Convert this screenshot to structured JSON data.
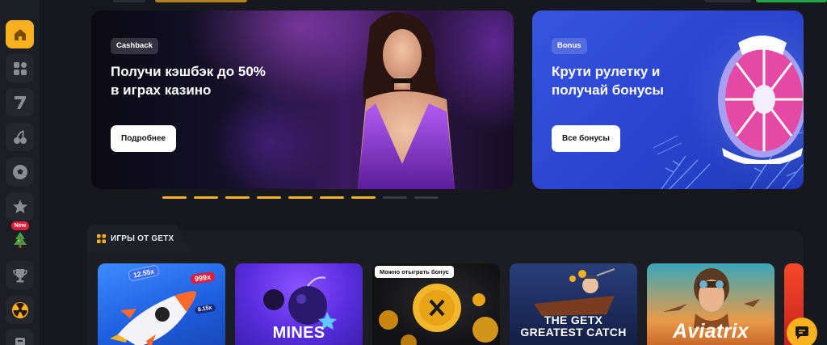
{
  "colors": {
    "accent": "#f9b11f",
    "background": "#17181d",
    "sidebar": "#1d1e24",
    "bonus_banner": "#2e4ad6",
    "new_badge": "#e01e3c"
  },
  "sidebar": {
    "items": [
      {
        "name": "home",
        "icon": "home-icon",
        "active": true
      },
      {
        "name": "categories",
        "icon": "grid-icon",
        "active": false
      },
      {
        "name": "slots",
        "icon": "seven-icon",
        "active": false
      },
      {
        "name": "fruits",
        "icon": "cherry-icon",
        "active": false
      },
      {
        "name": "sports",
        "icon": "soccer-ball-icon",
        "active": false
      },
      {
        "name": "favorites",
        "icon": "star-icon",
        "active": false
      },
      {
        "name": "new-year",
        "icon": "christmas-tree-icon",
        "active": false
      },
      {
        "name": "tournaments",
        "icon": "trophy-icon",
        "active": false
      },
      {
        "name": "game",
        "icon": "radiation-icon",
        "active": false
      },
      {
        "name": "more",
        "icon": "book-icon",
        "active": false
      }
    ],
    "new_badge": "New"
  },
  "banners": [
    {
      "tag": "Cashback",
      "title": "Получи кэшбэк до 50% в играх казино",
      "button": "Подробнее"
    },
    {
      "tag": "Bonus",
      "title": "Крути рулетку и получай бонусы",
      "button": "Все бонусы"
    }
  ],
  "carousel": {
    "total": 9,
    "active_count": 7
  },
  "games": {
    "title": "ИГРЫ ОТ GETX",
    "cards": [
      {
        "name": "Rocket",
        "badge": "",
        "multipliers": [
          "12.55x",
          "999x",
          "8.15x"
        ]
      },
      {
        "name": "MINES",
        "badge": ""
      },
      {
        "name": "Coins",
        "badge": "Можно отыграть бонус"
      },
      {
        "name": "THE GETX GREATEST CATCH",
        "badge": ""
      },
      {
        "name": "Aviatrix",
        "badge": ""
      }
    ]
  }
}
